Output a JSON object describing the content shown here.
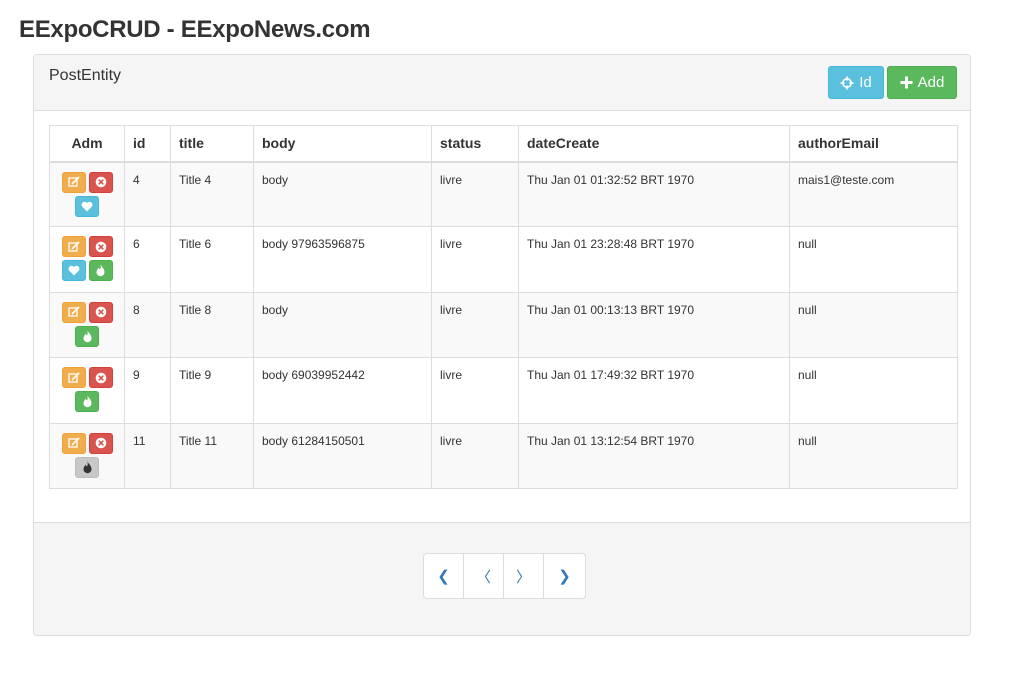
{
  "app": {
    "title": "EExpoCRUD - EExpoNews.com"
  },
  "panel": {
    "title": "PostEntity",
    "buttons": {
      "id_label": "Id",
      "add_label": "Add"
    }
  },
  "table": {
    "columns": [
      "Adm",
      "id",
      "title",
      "body",
      "status",
      "dateCreate",
      "authorEmail"
    ],
    "rows": [
      {
        "id": "4",
        "title": "Title 4",
        "body": "body",
        "status": "livre",
        "dateCreate": "Thu Jan 01 01:32:52 BRT 1970",
        "authorEmail": "mais1@teste.com",
        "actions": [
          "edit-icon",
          "delete-icon",
          "heart-icon"
        ]
      },
      {
        "id": "6",
        "title": "Title 6",
        "body": "body 97963596875",
        "status": "livre",
        "dateCreate": "Thu Jan 01 23:28:48 BRT 1970",
        "authorEmail": "null",
        "actions": [
          "edit-icon",
          "delete-icon",
          "heart-icon",
          "fire-icon"
        ]
      },
      {
        "id": "8",
        "title": "Title 8",
        "body": "body",
        "status": "livre",
        "dateCreate": "Thu Jan 01 00:13:13 BRT 1970",
        "authorEmail": "null",
        "actions": [
          "edit-icon",
          "delete-icon",
          "fire-icon"
        ]
      },
      {
        "id": "9",
        "title": "Title 9",
        "body": "body 69039952442",
        "status": "livre",
        "dateCreate": "Thu Jan 01 17:49:32 BRT 1970",
        "authorEmail": "null",
        "actions": [
          "edit-icon",
          "delete-icon",
          "fire-icon"
        ]
      },
      {
        "id": "11",
        "title": "Title 11",
        "body": "body 61284150501",
        "status": "livre",
        "dateCreate": "Thu Jan 01 13:12:54 BRT 1970",
        "authorEmail": "null",
        "actions": [
          "edit-icon",
          "delete-icon",
          "fire-off-icon"
        ]
      }
    ]
  },
  "pagination": {
    "first_label": "❮",
    "prev_label": "〈",
    "next_label": "〉",
    "last_label": "❯"
  },
  "colors": {
    "info": "#5bc0de",
    "success": "#5cb85c",
    "warning": "#f0ad4e",
    "danger": "#d9534f",
    "disabled": "#c8c8c8",
    "link": "#337ab7"
  }
}
